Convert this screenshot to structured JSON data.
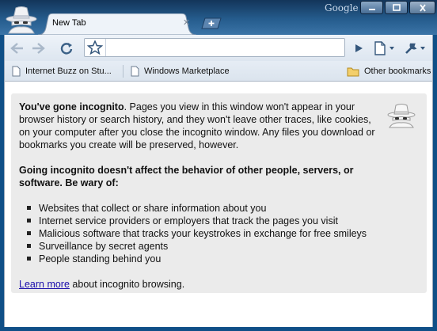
{
  "window": {
    "brand": "Google",
    "controls": {
      "minimize": "▁",
      "maximize": "☐",
      "close": "✕"
    }
  },
  "tabs": [
    {
      "title": "New Tab",
      "close": "✕"
    }
  ],
  "toolbar": {
    "address_value": "",
    "icons": [
      "back-icon",
      "forward-icon",
      "reload-icon",
      "star-icon",
      "go-icon",
      "page-menu-icon",
      "wrench-menu-icon"
    ]
  },
  "bookmarks": {
    "items": [
      {
        "label": "Internet Buzz on Stu...",
        "icon": "page-icon"
      },
      {
        "label": "Windows Marketplace",
        "icon": "page-icon"
      }
    ],
    "other": {
      "label": "Other bookmarks",
      "icon": "folder-icon"
    }
  },
  "incognito": {
    "intro_bold": "You've gone incognito",
    "intro_rest": ". Pages you view in this window won't appear in your browser history or search history, and they won't leave other traces, like cookies, on your computer after you close the incognito window. Any files you download or bookmarks you create will be preserved, however.",
    "warning_heading": "Going incognito doesn't affect the behavior of other people, servers, or software. Be wary of:",
    "wary_items": [
      "Websites that collect or share information about you",
      "Internet service providers or employers that track the pages you visit",
      "Malicious software that tracks your keystrokes in exchange for free smileys",
      "Surveillance by secret agents",
      "People standing behind you"
    ],
    "learn_more_link": "Learn more",
    "learn_more_rest": " about incognito browsing."
  }
}
